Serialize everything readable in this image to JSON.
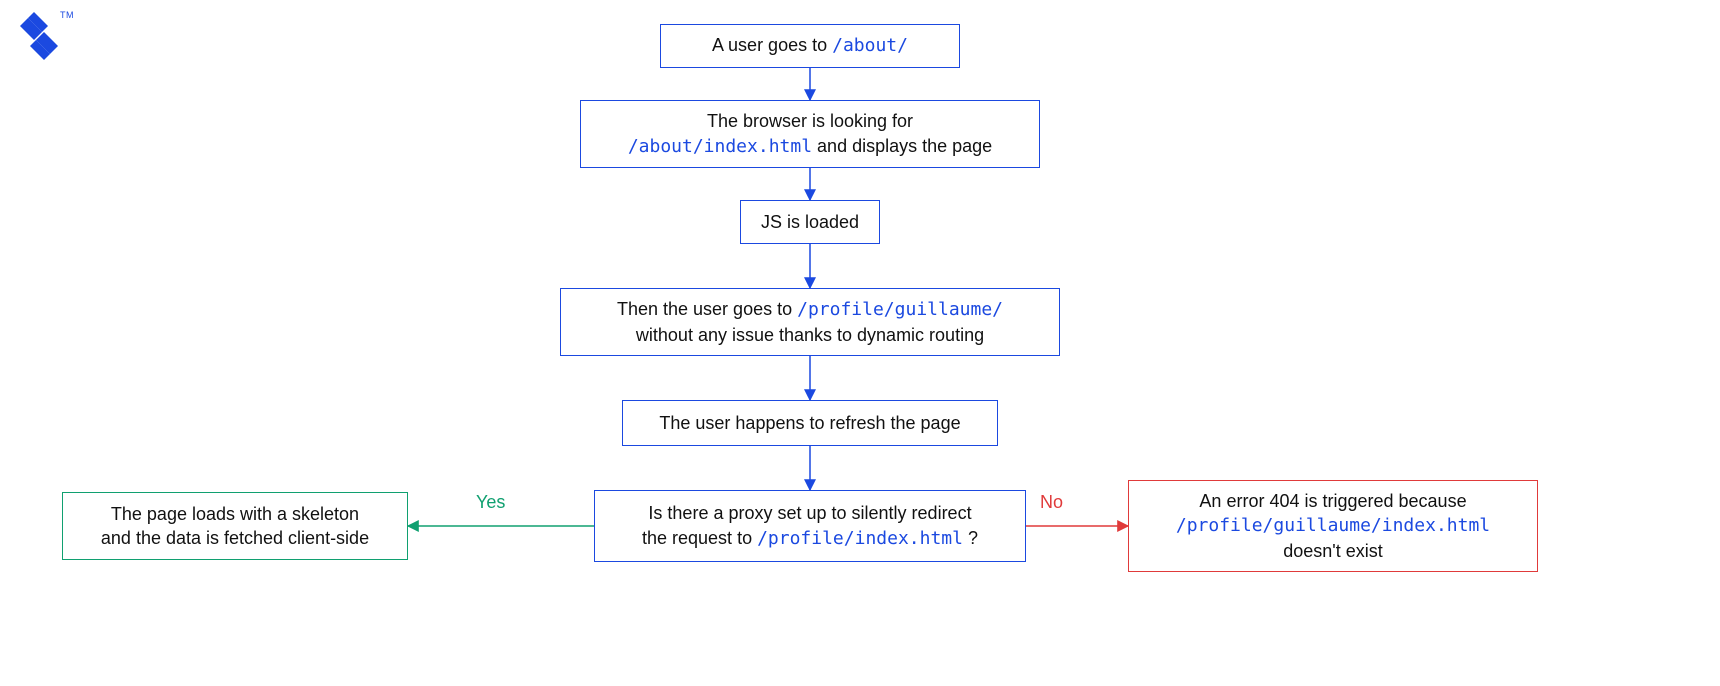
{
  "logo": {
    "tm": "TM"
  },
  "colors": {
    "blue": "#1b49e0",
    "green": "#10a070",
    "red": "#e03a3a"
  },
  "nodes": {
    "n1": {
      "pre": "A user goes to ",
      "code": "/about/",
      "post": ""
    },
    "n2": {
      "line1_pre": "The browser is looking for",
      "line2_code": "/about/index.html",
      "line2_post": " and displays the page"
    },
    "n3": {
      "text": "JS is loaded"
    },
    "n4": {
      "line1_pre": "Then the user goes to ",
      "line1_code": "/profile/guillaume/",
      "line2": "without any issue thanks to dynamic routing"
    },
    "n5": {
      "text": "The user happens to refresh the page"
    },
    "n6": {
      "line1": "Is there a proxy set up to silently redirect",
      "line2_pre": "the request to ",
      "line2_code": "/profile/index.html",
      "line2_post": " ?"
    },
    "nYes": {
      "line1": "The page loads with a skeleton",
      "line2": "and the data is fetched client-side"
    },
    "nNo": {
      "line1": "An error 404 is triggered because",
      "line2_code": "/profile/guillaume/index.html",
      "line3": "doesn't exist"
    }
  },
  "edges": {
    "yes": "Yes",
    "no": "No"
  }
}
